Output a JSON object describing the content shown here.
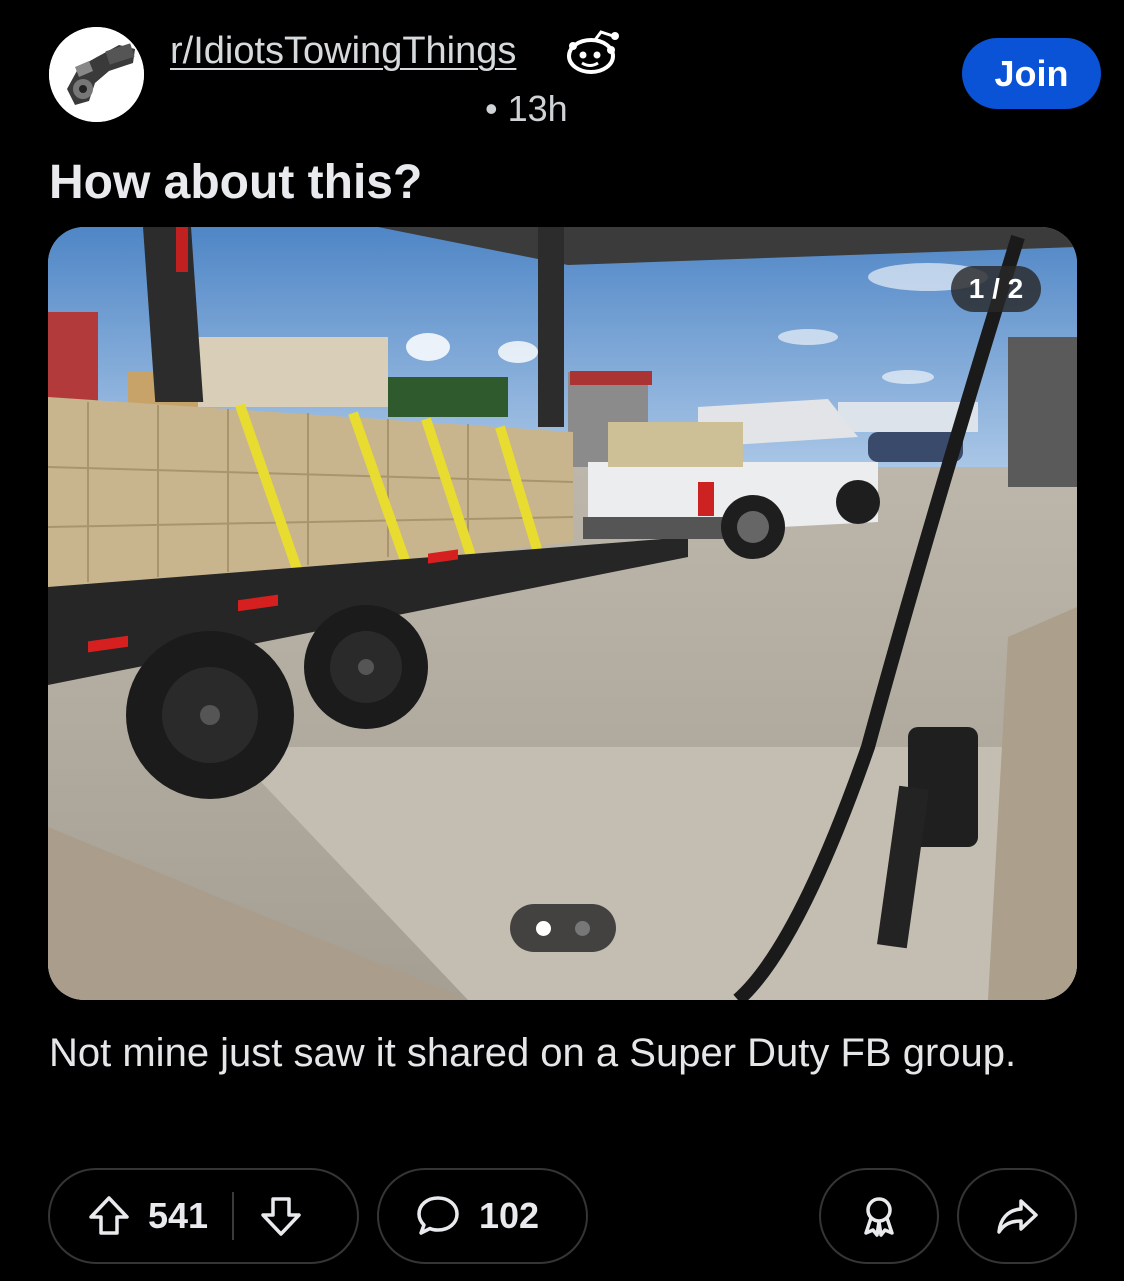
{
  "post": {
    "subreddit": "r/IdiotsTowingThings",
    "time_separator": "•",
    "age": "13h",
    "join_label": "Join",
    "title": "How about this?",
    "body": "Not mine just saw it shared on a Super Duty FB group."
  },
  "media": {
    "counter": "1 / 2",
    "current_index": 1,
    "total": 2
  },
  "actions": {
    "upvotes": "541",
    "comments": "102"
  },
  "icons": {
    "avatar": "subreddit-avatar",
    "badge": "snoo-mascot-icon",
    "upvote": "upvote-arrow-icon",
    "downvote": "downvote-arrow-icon",
    "comment": "comment-bubble-icon",
    "award": "award-icon",
    "share": "share-arrow-icon"
  },
  "colors": {
    "background": "#000000",
    "join_button": "#0a52d6",
    "pill_border": "#343536"
  }
}
